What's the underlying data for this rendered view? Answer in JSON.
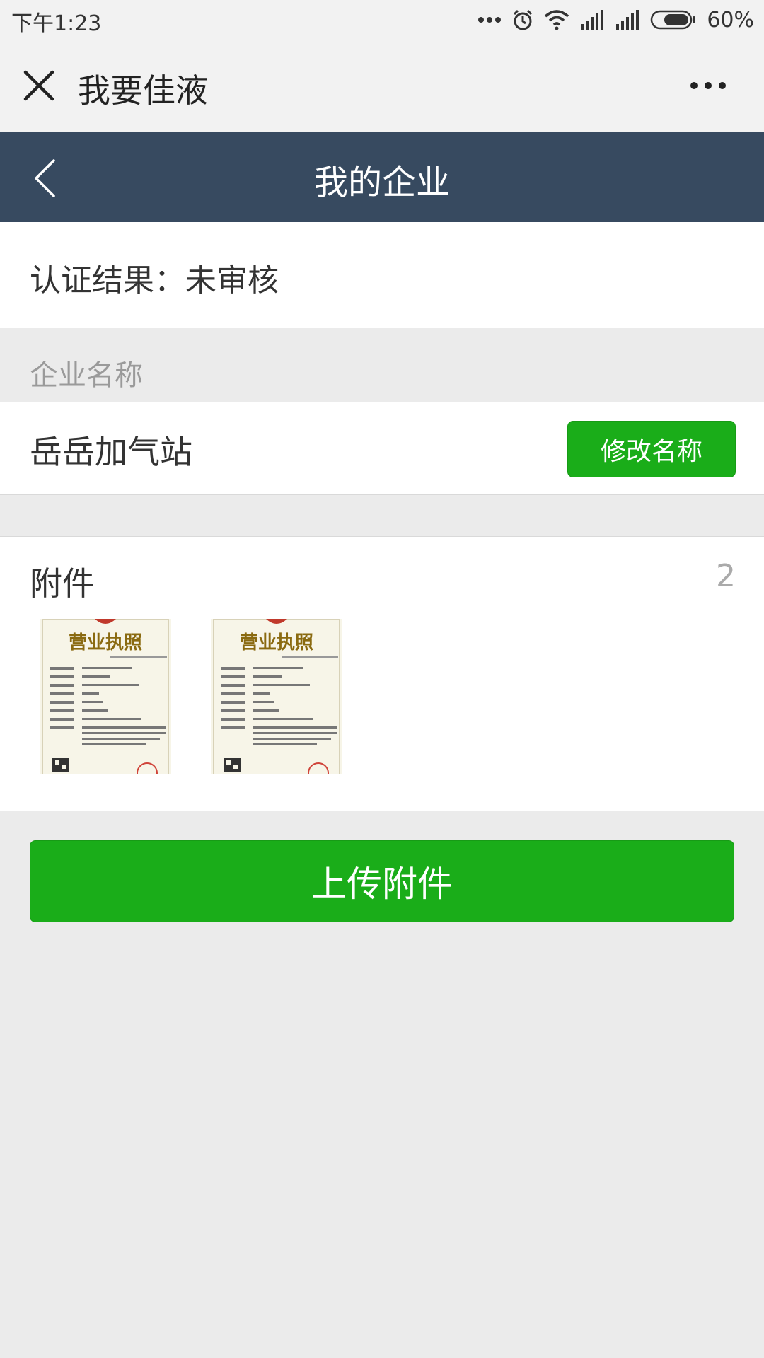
{
  "status_bar": {
    "time": "下午1:23",
    "battery": "60%",
    "icons": [
      "more-dots-icon",
      "alarm-icon",
      "wifi-icon",
      "signal-icon",
      "signal-icon",
      "battery-icon"
    ]
  },
  "wechat_bar": {
    "title": "我要佳液",
    "close_icon": "close-icon",
    "more_icon": "more-icon"
  },
  "navbar": {
    "title": "我的企业",
    "back_icon": "chevron-left-icon",
    "background": "#374a60"
  },
  "certification": {
    "text": "认证结果：未审核"
  },
  "company": {
    "section_label": "企业名称",
    "name": "岳岳加气站",
    "rename_button": "修改名称"
  },
  "attachments": {
    "title": "附件",
    "count": "2",
    "items": [
      {
        "title": "营业执照"
      },
      {
        "title": "营业执照"
      }
    ]
  },
  "upload_button": "上传附件",
  "colors": {
    "primary_green": "#1aad19",
    "navbar": "#374a60",
    "page_bg": "#ebebeb"
  }
}
